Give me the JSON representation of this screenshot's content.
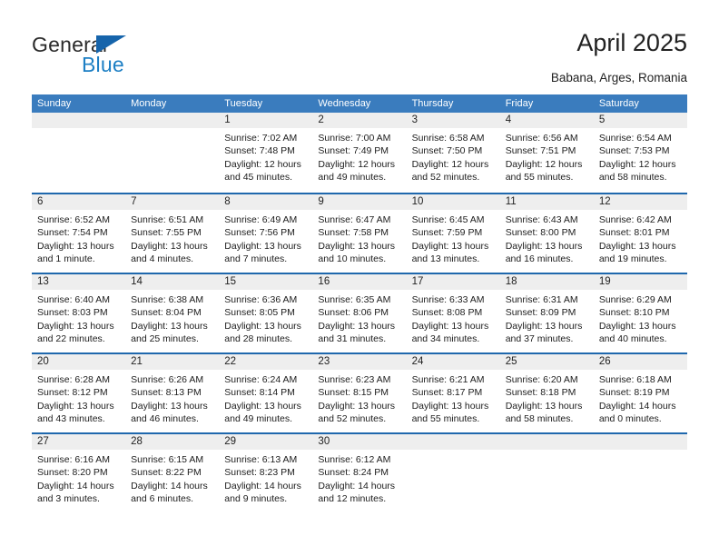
{
  "brand": {
    "name_primary": "General",
    "name_secondary": "Blue",
    "primary_color": "#2b2b2b",
    "secondary_color": "#1d7fc4",
    "accent_color": "#1664ab"
  },
  "header": {
    "title": "April 2025",
    "subtitle": "Babana, Arges, Romania"
  },
  "calendar": {
    "header_bg": "#3a7cbe",
    "row_divider_color": "#1f68ad",
    "day_number_bg": "#eeeeee",
    "weekdays": [
      "Sunday",
      "Monday",
      "Tuesday",
      "Wednesday",
      "Thursday",
      "Friday",
      "Saturday"
    ],
    "weeks": [
      [
        {
          "day": "",
          "lines": []
        },
        {
          "day": "",
          "lines": []
        },
        {
          "day": "1",
          "lines": [
            "Sunrise: 7:02 AM",
            "Sunset: 7:48 PM",
            "Daylight: 12 hours",
            "and 45 minutes."
          ]
        },
        {
          "day": "2",
          "lines": [
            "Sunrise: 7:00 AM",
            "Sunset: 7:49 PM",
            "Daylight: 12 hours",
            "and 49 minutes."
          ]
        },
        {
          "day": "3",
          "lines": [
            "Sunrise: 6:58 AM",
            "Sunset: 7:50 PM",
            "Daylight: 12 hours",
            "and 52 minutes."
          ]
        },
        {
          "day": "4",
          "lines": [
            "Sunrise: 6:56 AM",
            "Sunset: 7:51 PM",
            "Daylight: 12 hours",
            "and 55 minutes."
          ]
        },
        {
          "day": "5",
          "lines": [
            "Sunrise: 6:54 AM",
            "Sunset: 7:53 PM",
            "Daylight: 12 hours",
            "and 58 minutes."
          ]
        }
      ],
      [
        {
          "day": "6",
          "lines": [
            "Sunrise: 6:52 AM",
            "Sunset: 7:54 PM",
            "Daylight: 13 hours",
            "and 1 minute."
          ]
        },
        {
          "day": "7",
          "lines": [
            "Sunrise: 6:51 AM",
            "Sunset: 7:55 PM",
            "Daylight: 13 hours",
            "and 4 minutes."
          ]
        },
        {
          "day": "8",
          "lines": [
            "Sunrise: 6:49 AM",
            "Sunset: 7:56 PM",
            "Daylight: 13 hours",
            "and 7 minutes."
          ]
        },
        {
          "day": "9",
          "lines": [
            "Sunrise: 6:47 AM",
            "Sunset: 7:58 PM",
            "Daylight: 13 hours",
            "and 10 minutes."
          ]
        },
        {
          "day": "10",
          "lines": [
            "Sunrise: 6:45 AM",
            "Sunset: 7:59 PM",
            "Daylight: 13 hours",
            "and 13 minutes."
          ]
        },
        {
          "day": "11",
          "lines": [
            "Sunrise: 6:43 AM",
            "Sunset: 8:00 PM",
            "Daylight: 13 hours",
            "and 16 minutes."
          ]
        },
        {
          "day": "12",
          "lines": [
            "Sunrise: 6:42 AM",
            "Sunset: 8:01 PM",
            "Daylight: 13 hours",
            "and 19 minutes."
          ]
        }
      ],
      [
        {
          "day": "13",
          "lines": [
            "Sunrise: 6:40 AM",
            "Sunset: 8:03 PM",
            "Daylight: 13 hours",
            "and 22 minutes."
          ]
        },
        {
          "day": "14",
          "lines": [
            "Sunrise: 6:38 AM",
            "Sunset: 8:04 PM",
            "Daylight: 13 hours",
            "and 25 minutes."
          ]
        },
        {
          "day": "15",
          "lines": [
            "Sunrise: 6:36 AM",
            "Sunset: 8:05 PM",
            "Daylight: 13 hours",
            "and 28 minutes."
          ]
        },
        {
          "day": "16",
          "lines": [
            "Sunrise: 6:35 AM",
            "Sunset: 8:06 PM",
            "Daylight: 13 hours",
            "and 31 minutes."
          ]
        },
        {
          "day": "17",
          "lines": [
            "Sunrise: 6:33 AM",
            "Sunset: 8:08 PM",
            "Daylight: 13 hours",
            "and 34 minutes."
          ]
        },
        {
          "day": "18",
          "lines": [
            "Sunrise: 6:31 AM",
            "Sunset: 8:09 PM",
            "Daylight: 13 hours",
            "and 37 minutes."
          ]
        },
        {
          "day": "19",
          "lines": [
            "Sunrise: 6:29 AM",
            "Sunset: 8:10 PM",
            "Daylight: 13 hours",
            "and 40 minutes."
          ]
        }
      ],
      [
        {
          "day": "20",
          "lines": [
            "Sunrise: 6:28 AM",
            "Sunset: 8:12 PM",
            "Daylight: 13 hours",
            "and 43 minutes."
          ]
        },
        {
          "day": "21",
          "lines": [
            "Sunrise: 6:26 AM",
            "Sunset: 8:13 PM",
            "Daylight: 13 hours",
            "and 46 minutes."
          ]
        },
        {
          "day": "22",
          "lines": [
            "Sunrise: 6:24 AM",
            "Sunset: 8:14 PM",
            "Daylight: 13 hours",
            "and 49 minutes."
          ]
        },
        {
          "day": "23",
          "lines": [
            "Sunrise: 6:23 AM",
            "Sunset: 8:15 PM",
            "Daylight: 13 hours",
            "and 52 minutes."
          ]
        },
        {
          "day": "24",
          "lines": [
            "Sunrise: 6:21 AM",
            "Sunset: 8:17 PM",
            "Daylight: 13 hours",
            "and 55 minutes."
          ]
        },
        {
          "day": "25",
          "lines": [
            "Sunrise: 6:20 AM",
            "Sunset: 8:18 PM",
            "Daylight: 13 hours",
            "and 58 minutes."
          ]
        },
        {
          "day": "26",
          "lines": [
            "Sunrise: 6:18 AM",
            "Sunset: 8:19 PM",
            "Daylight: 14 hours",
            "and 0 minutes."
          ]
        }
      ],
      [
        {
          "day": "27",
          "lines": [
            "Sunrise: 6:16 AM",
            "Sunset: 8:20 PM",
            "Daylight: 14 hours",
            "and 3 minutes."
          ]
        },
        {
          "day": "28",
          "lines": [
            "Sunrise: 6:15 AM",
            "Sunset: 8:22 PM",
            "Daylight: 14 hours",
            "and 6 minutes."
          ]
        },
        {
          "day": "29",
          "lines": [
            "Sunrise: 6:13 AM",
            "Sunset: 8:23 PM",
            "Daylight: 14 hours",
            "and 9 minutes."
          ]
        },
        {
          "day": "30",
          "lines": [
            "Sunrise: 6:12 AM",
            "Sunset: 8:24 PM",
            "Daylight: 14 hours",
            "and 12 minutes."
          ]
        },
        {
          "day": "",
          "lines": []
        },
        {
          "day": "",
          "lines": []
        },
        {
          "day": "",
          "lines": []
        }
      ]
    ]
  }
}
